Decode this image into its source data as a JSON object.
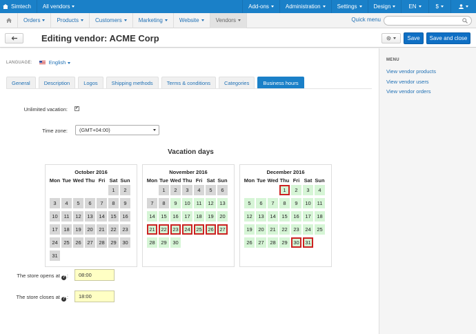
{
  "topbar": {
    "brand": "Simtech",
    "store_selector": "All vendors",
    "addons": "Add-ons",
    "administration": "Administration",
    "settings": "Settings",
    "design": "Design",
    "language": "EN",
    "currency": "$",
    "accent": "#1a80c8"
  },
  "nav": {
    "items": [
      "Orders",
      "Products",
      "Customers",
      "Marketing",
      "Website",
      "Vendors"
    ],
    "active": "Vendors",
    "quick_menu": "Quick menu",
    "search_placeholder": ""
  },
  "header": {
    "title": "Editing vendor: ACME Corp",
    "save": "Save",
    "save_close": "Save and close"
  },
  "language": {
    "label": "LANGUAGE:",
    "value": "English"
  },
  "tabs": [
    "General",
    "Description",
    "Logos",
    "Shipping methods",
    "Terms & conditions",
    "Categories",
    "Business hours"
  ],
  "active_tab": "Business hours",
  "form": {
    "unlimited_vacation_label": "Unlimited vacation:",
    "unlimited_vacation_checked": true,
    "timezone_label": "Time zone:",
    "timezone_value": "(GMT+04:00)",
    "vacation_title": "Vacation days",
    "opens_label": "The store opens at",
    "opens_value": "08:00",
    "closes_label": "The store closes at",
    "closes_value": "18:00"
  },
  "weekdays": [
    "Mon",
    "Tue",
    "Wed",
    "Thu",
    "Fri",
    "Sat",
    "Sun"
  ],
  "calendars": [
    {
      "title": "October 2016",
      "offset": 5,
      "days": 31,
      "past_through": 31,
      "avail_from": 32,
      "selected": []
    },
    {
      "title": "November 2016",
      "offset": 1,
      "days": 30,
      "past_through": 6,
      "avail_from": 7,
      "avail_exceptions": [
        7,
        8
      ],
      "selected": [
        21,
        22,
        23,
        24,
        25,
        26,
        27
      ]
    },
    {
      "title": "December 2016",
      "offset": 3,
      "days": 31,
      "past_through": 0,
      "avail_from": 1,
      "selected": [
        1,
        30,
        31
      ]
    }
  ],
  "sidebar": {
    "title": "MENU",
    "links": [
      "View vendor products",
      "View vendor users",
      "View vendor orders"
    ]
  }
}
